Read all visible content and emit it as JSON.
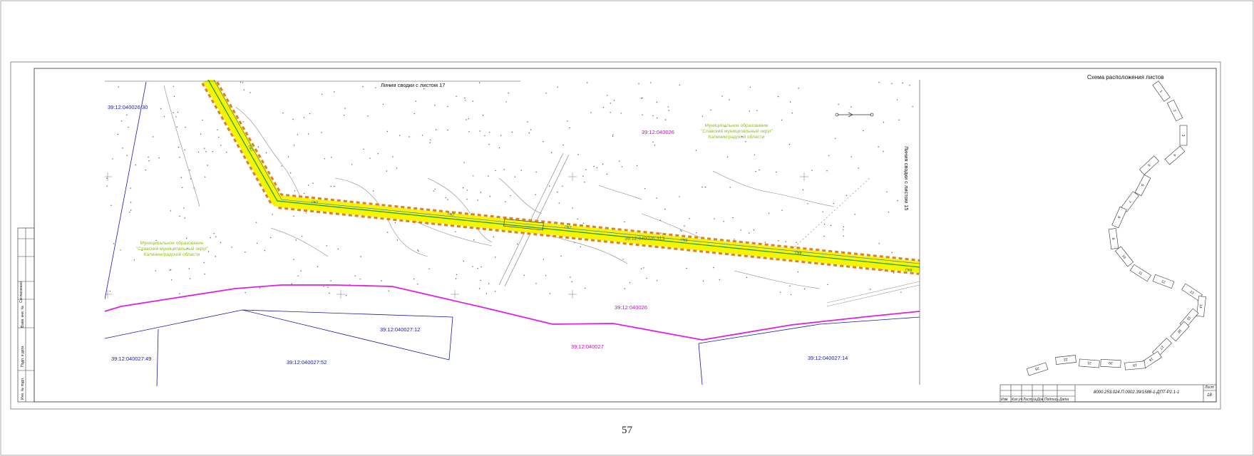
{
  "page": {
    "number": "57"
  },
  "map": {
    "seam_top": "Линия сводки с листом 17",
    "seam_right": "Линия сводки с листом 15",
    "parcels": {
      "p1": "39:12:040026:30",
      "p2": "39:12:040026",
      "p3": "39:12:040026:313",
      "p4": "39:12:040026",
      "p5": "39:12:040027:12",
      "p6": "39:12:040027",
      "p7": "39:12:040027:49",
      "p8": "39:12:040027:52",
      "p9": "39:12:040027:14"
    },
    "municipality_right": [
      "Муниципальное образование",
      "\"Славский муниципальный округ\"",
      "Калининградской области"
    ],
    "municipality_left": [
      "Муниципальное образование",
      "\"Славский муниципальный округ\"",
      "Калининградской области"
    ],
    "colors": {
      "corridor": "#f5f500",
      "corridor_edge": "#e08020",
      "axis": "#1b9a3c",
      "parcel_line": "#1a1aa8",
      "boundary": "#e020e0",
      "muni_text": "#8cc21a"
    }
  },
  "layout_scheme": {
    "title": "Схема расположения листов",
    "sheet_numbers": [
      "1",
      "2",
      "3",
      "4",
      "5",
      "6",
      "7",
      "8",
      "9",
      "10",
      "11",
      "12",
      "13",
      "14",
      "15",
      "16",
      "17",
      "18",
      "19",
      "20",
      "21",
      "22",
      "23"
    ]
  },
  "side_stamp": [
    "Согласовано",
    "Взам. инв. №",
    "Подп. и дата",
    "Инв. № подл."
  ],
  "title_block": {
    "code": "8000.253.024.П.0002.39/1588-1-ДПТ-Р2.1-1",
    "sheet_label": "Лист",
    "sheet_number": "18",
    "columns": [
      "Изм.",
      "Кол.уч",
      "Лист",
      "№Док",
      "Подпись",
      "Дата"
    ]
  }
}
